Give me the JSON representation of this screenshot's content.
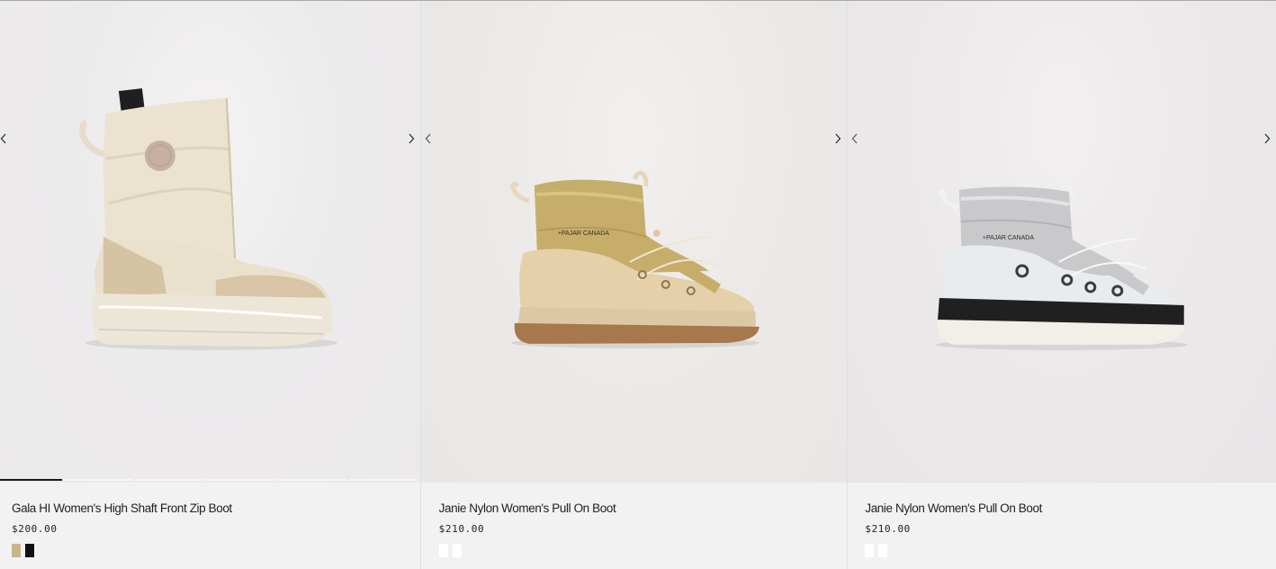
{
  "products": [
    {
      "title": "Gala HI Women's High Shaft Front Zip Boot",
      "price": "$200.00",
      "swatches": [
        "#cbb48a",
        "#111111"
      ],
      "image_count": 6,
      "active_image": 1
    },
    {
      "title": "Janie Nylon Women's Pull On Boot",
      "price": "$210.00",
      "swatches": [
        "#ffffff",
        "#ffffff"
      ]
    },
    {
      "title": "Janie Nylon Women's Pull On Boot",
      "price": "$210.00",
      "swatches": [
        "#ffffff",
        "#ffffff"
      ]
    }
  ]
}
